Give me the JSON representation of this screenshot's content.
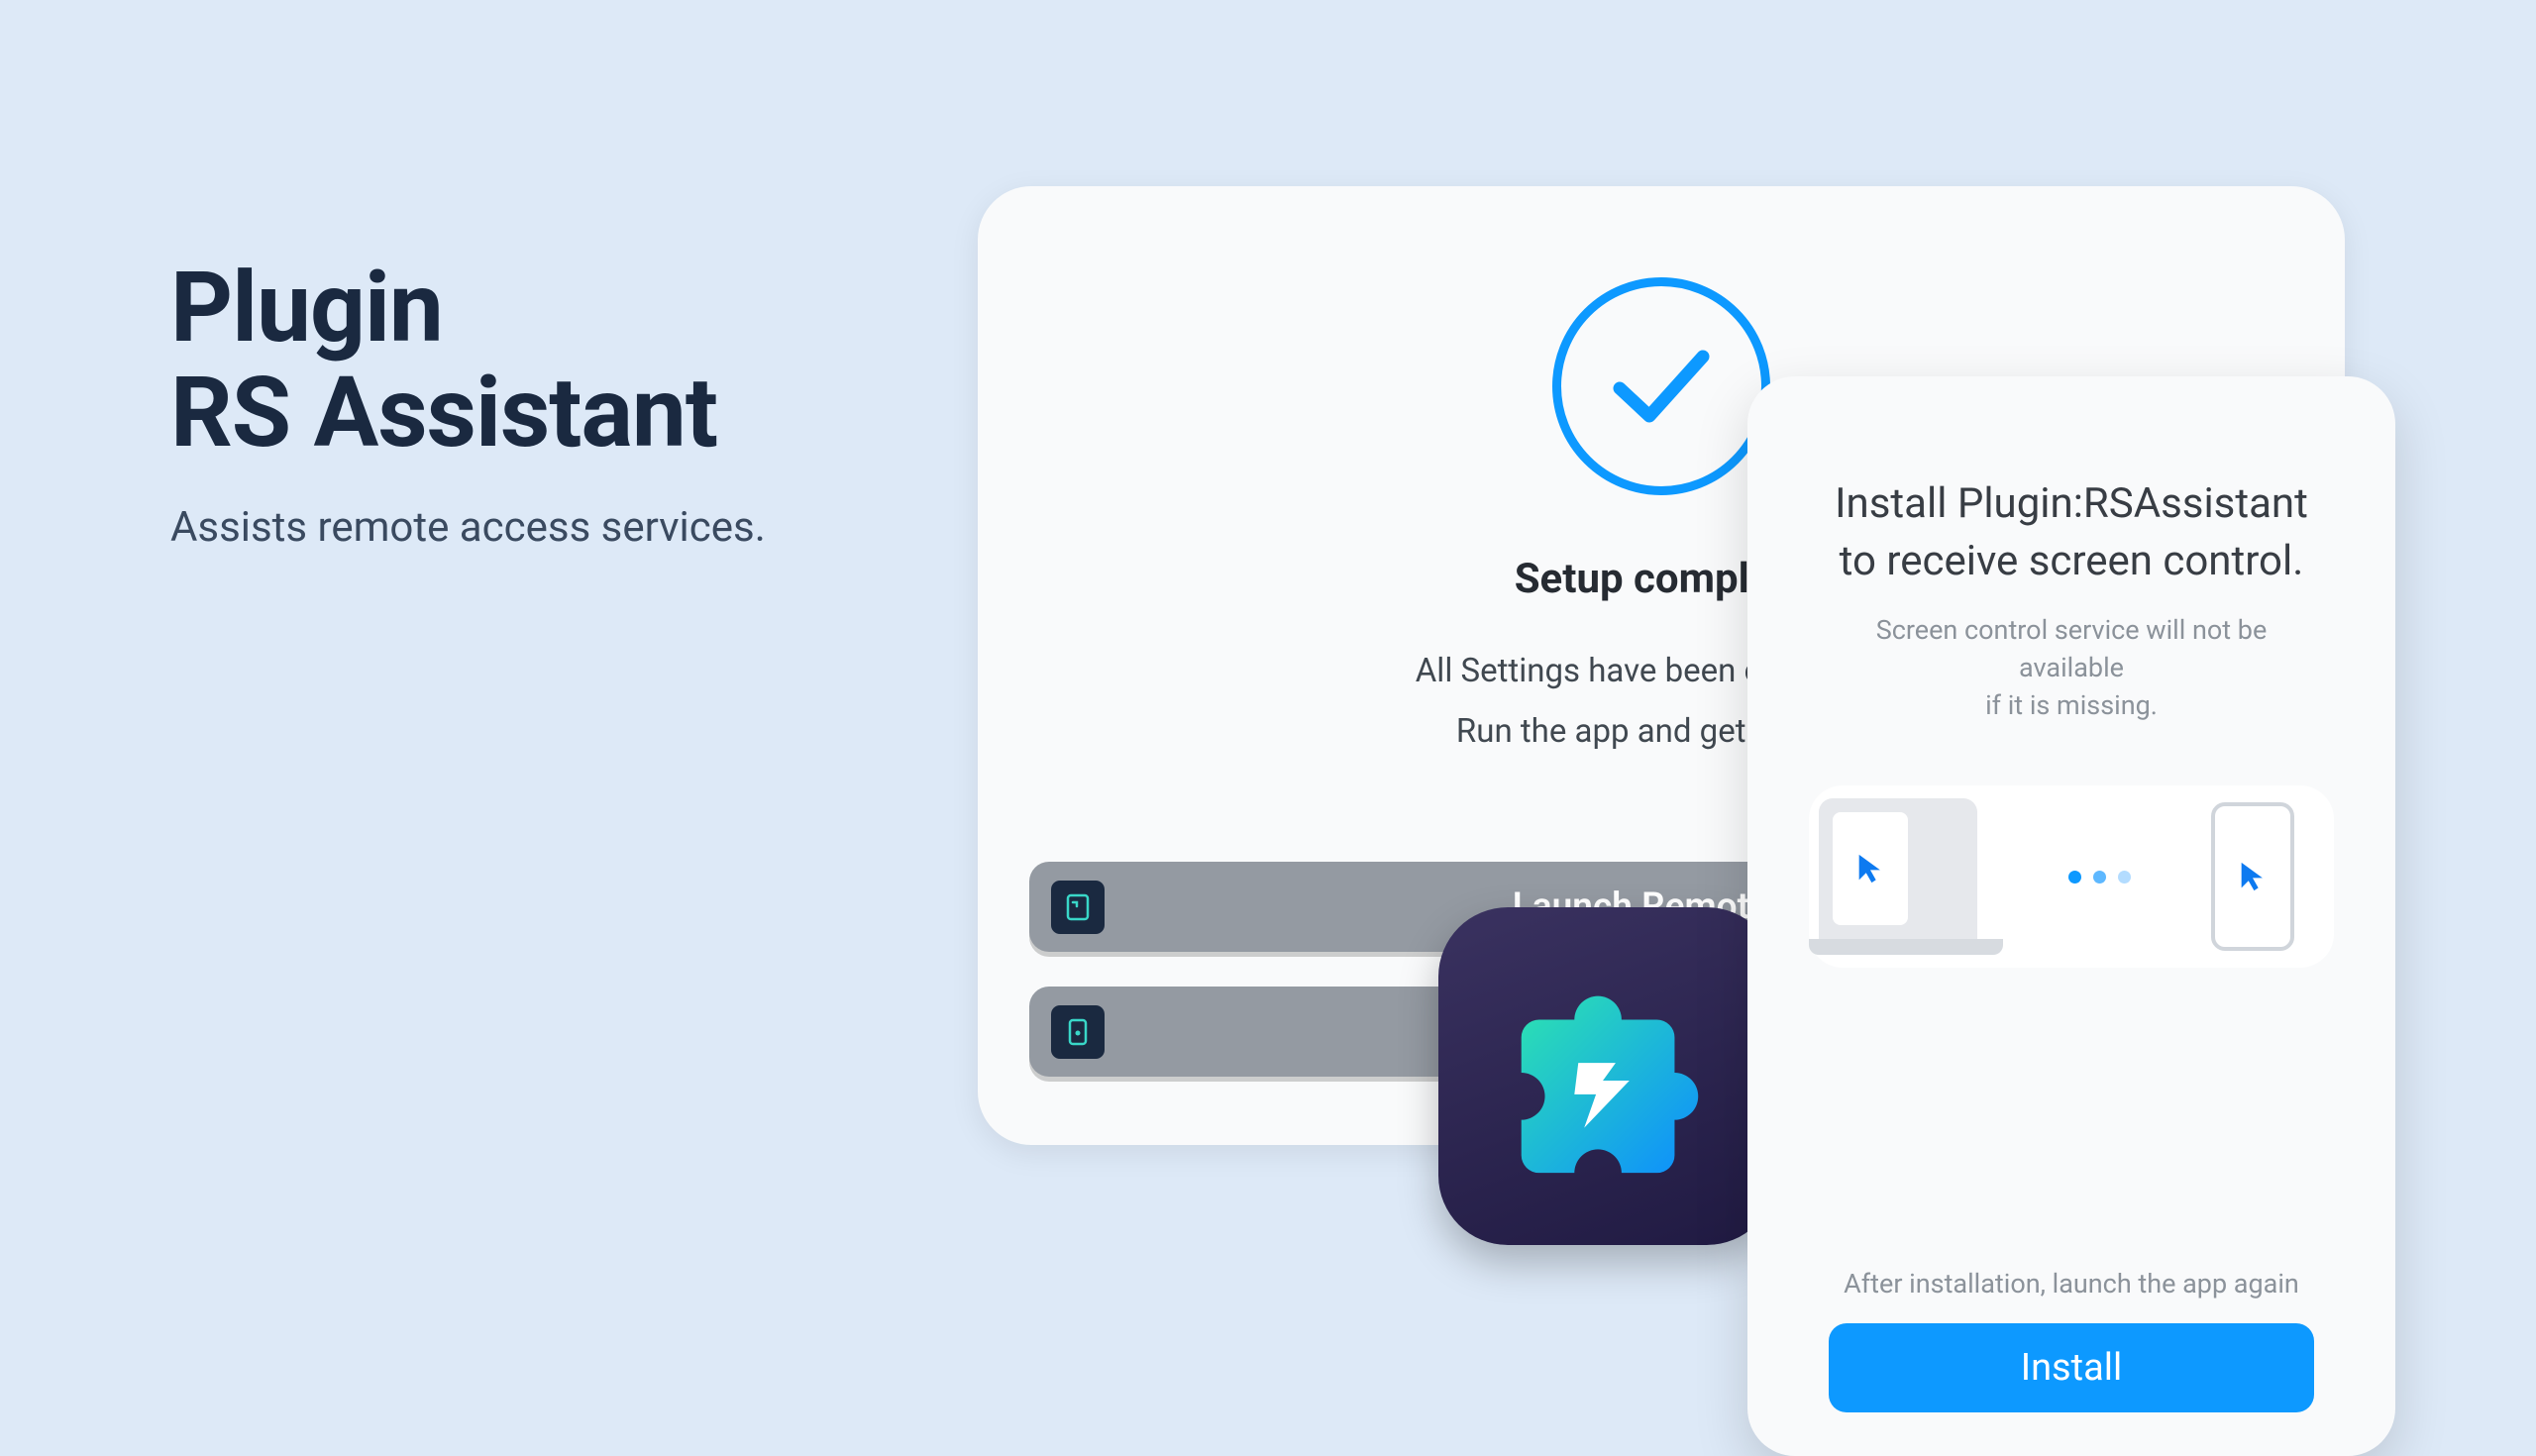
{
  "header": {
    "title_line1": "Plugin",
    "title_line2": "RS Assistant",
    "subtitle": "Assists remote access services."
  },
  "back_card": {
    "title": "Setup complete",
    "desc_line1": "All Settings have been completed.",
    "desc_line2": "Run the app and get started.",
    "launch1_label": "Launch RemoteCall",
    "launch2_label": ""
  },
  "front_card": {
    "title_line1": "Install Plugin:RSAssistant",
    "title_line2": "to receive screen control.",
    "desc_line1": "Screen control service will not be available",
    "desc_line2": "if it is missing.",
    "footer_text": "After installation, launch the app again",
    "install_label": "Install"
  },
  "icons": {
    "check": "check-icon",
    "puzzle": "puzzle-icon",
    "cursor": "cursor-icon",
    "launch_app1": "remotecall-app-icon",
    "launch_app2": "app-icon"
  },
  "colors": {
    "accent": "#0d99ff",
    "bg": "#dde9f7",
    "dark": "#1a2940"
  }
}
